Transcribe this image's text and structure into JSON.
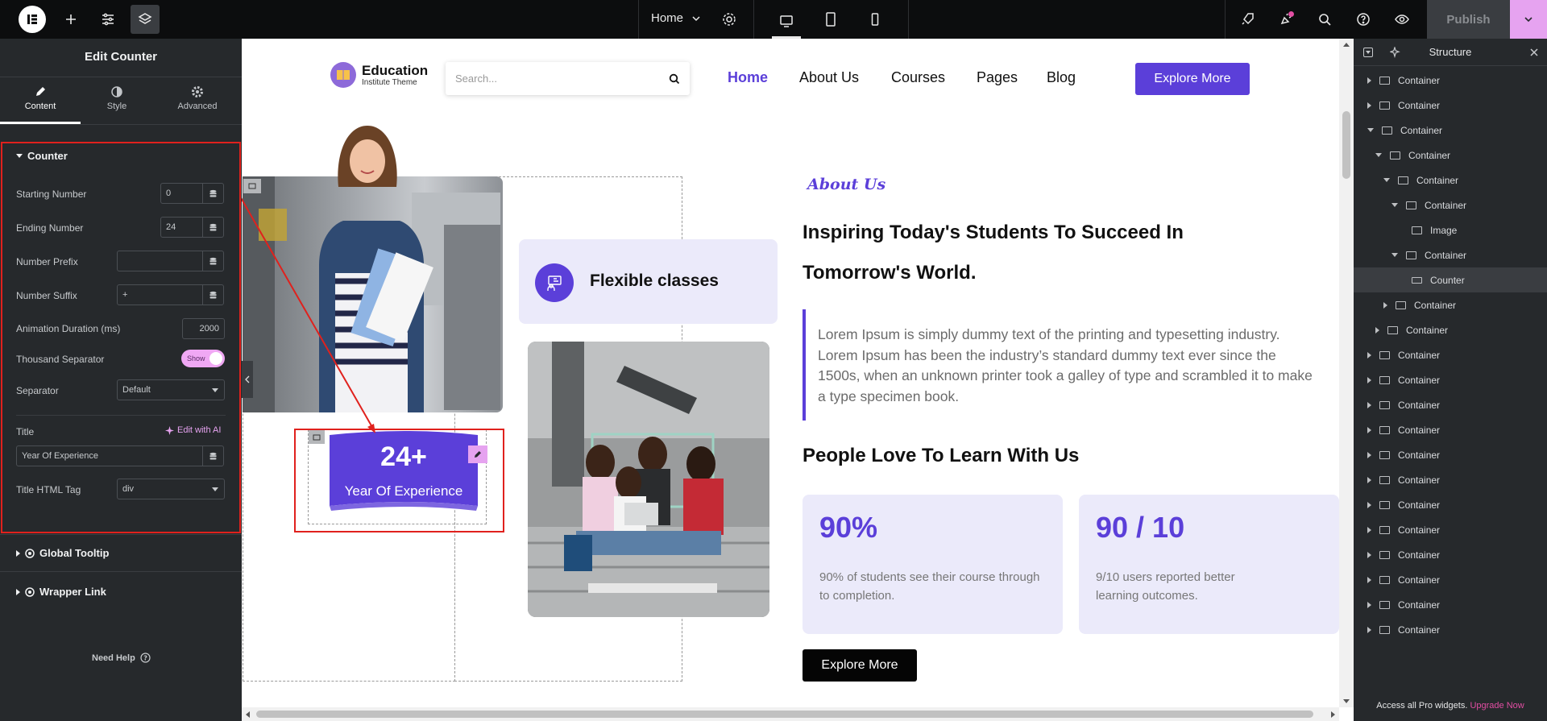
{
  "topbar": {
    "page_selector": "Home",
    "publish_label": "Publish"
  },
  "left_panel": {
    "title": "Edit Counter",
    "tabs": [
      {
        "label": "Content",
        "icon": "pencil-icon"
      },
      {
        "label": "Style",
        "icon": "half-circle-icon"
      },
      {
        "label": "Advanced",
        "icon": "gear-icon"
      }
    ],
    "section_title": "Counter",
    "fields": {
      "starting_number": {
        "label": "Starting Number",
        "value": "0"
      },
      "ending_number": {
        "label": "Ending Number",
        "value": "24"
      },
      "number_prefix": {
        "label": "Number Prefix",
        "value": ""
      },
      "number_suffix": {
        "label": "Number Suffix",
        "value": "+"
      },
      "animation_duration": {
        "label": "Animation Duration (ms)",
        "value": "2000"
      },
      "thousand_separator": {
        "label": "Thousand Separator",
        "toggle": "Show"
      },
      "separator": {
        "label": "Separator",
        "value": "Default"
      },
      "title": {
        "label": "Title",
        "ai_label": "Edit with AI",
        "value": "Year Of Experience"
      },
      "title_html_tag": {
        "label": "Title HTML Tag",
        "value": "div"
      }
    },
    "collapsed_sections": [
      "Global Tooltip",
      "Wrapper Link"
    ],
    "need_help": "Need Help"
  },
  "canvas": {
    "brand_name": "Education",
    "brand_tagline": "Institute Theme",
    "search_placeholder": "Search...",
    "nav": [
      "Home",
      "About Us",
      "Courses",
      "Pages",
      "Blog"
    ],
    "nav_cta": "Explore More",
    "flexible_classes": "Flexible classes",
    "counter_number": "24+",
    "counter_title": "Year Of Experience",
    "about_tag": "About Us",
    "heading": "Inspiring Today's Students To Succeed In Tomorrow's World.",
    "quote": "Lorem Ipsum is simply dummy text of the printing and typesetting industry. Lorem Ipsum has been the industry’s standard dummy text ever since the 1500s, when an unknown printer took a galley of type and scrambled it to make a type specimen book.",
    "people_heading": "People Love To Learn With Us",
    "stats": [
      {
        "value": "90%",
        "text": "90% of students see their course through to completion."
      },
      {
        "value": "90 / 10",
        "text": "9/10 users reported better learning outcomes."
      }
    ],
    "bottom_cta": "Explore More"
  },
  "right_panel": {
    "title": "Structure",
    "tree": [
      {
        "label": "Container",
        "depth": 0,
        "state": "closed",
        "icon": "container-icon"
      },
      {
        "label": "Container",
        "depth": 0,
        "state": "closed",
        "icon": "container-icon"
      },
      {
        "label": "Container",
        "depth": 0,
        "state": "open",
        "icon": "container-icon"
      },
      {
        "label": "Container",
        "depth": 1,
        "state": "open",
        "icon": "container-icon"
      },
      {
        "label": "Container",
        "depth": 2,
        "state": "open",
        "icon": "container-icon"
      },
      {
        "label": "Container",
        "depth": 3,
        "state": "open",
        "icon": "container-icon"
      },
      {
        "label": "Image",
        "depth": 4,
        "state": "none",
        "icon": "image-icon"
      },
      {
        "label": "Container",
        "depth": 3,
        "state": "open",
        "icon": "container-icon"
      },
      {
        "label": "Counter",
        "depth": 4,
        "state": "none",
        "icon": "counter-icon",
        "selected": true
      },
      {
        "label": "Container",
        "depth": 2,
        "state": "closed",
        "icon": "container-icon"
      },
      {
        "label": "Container",
        "depth": 1,
        "state": "closed",
        "icon": "container-icon"
      },
      {
        "label": "Container",
        "depth": 0,
        "state": "closed",
        "icon": "container-icon"
      },
      {
        "label": "Container",
        "depth": 0,
        "state": "closed",
        "icon": "container-icon"
      },
      {
        "label": "Container",
        "depth": 0,
        "state": "closed",
        "icon": "container-icon"
      },
      {
        "label": "Container",
        "depth": 0,
        "state": "closed",
        "icon": "container-icon"
      },
      {
        "label": "Container",
        "depth": 0,
        "state": "closed",
        "icon": "container-icon"
      },
      {
        "label": "Container",
        "depth": 0,
        "state": "closed",
        "icon": "container-icon"
      },
      {
        "label": "Container",
        "depth": 0,
        "state": "closed",
        "icon": "container-icon"
      },
      {
        "label": "Container",
        "depth": 0,
        "state": "closed",
        "icon": "container-icon"
      },
      {
        "label": "Container",
        "depth": 0,
        "state": "closed",
        "icon": "container-icon"
      },
      {
        "label": "Container",
        "depth": 0,
        "state": "closed",
        "icon": "container-icon"
      },
      {
        "label": "Container",
        "depth": 0,
        "state": "closed",
        "icon": "container-icon"
      },
      {
        "label": "Container",
        "depth": 0,
        "state": "closed",
        "icon": "container-icon"
      }
    ],
    "footer_text": "Access all Pro widgets.",
    "footer_link": "Upgrade Now"
  },
  "colors": {
    "accent": "#5b3fd9",
    "selection_red": "#e0211d",
    "dark_bg": "#26292c",
    "card_bg": "#ebeafa",
    "pro_pink": "#e24ea3"
  }
}
